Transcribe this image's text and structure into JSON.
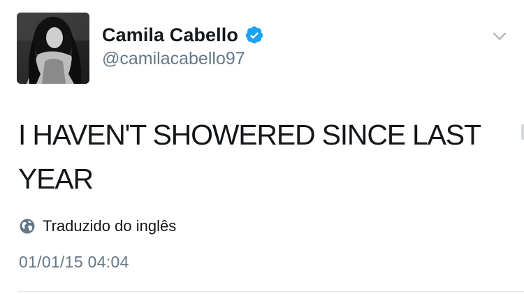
{
  "user": {
    "display_name": "Camila Cabello",
    "handle": "@camilacabello97",
    "verified": true,
    "avatar_icon": "profile-photo"
  },
  "tweet": {
    "text": "I HAVEN'T SHOWERED SINCE LAST YEAR",
    "translation_label": "Traduzido do inglês",
    "translation_icon": "globe-icon",
    "timestamp": "01/01/15 04:04"
  },
  "actions": {
    "menu_icon": "chevron-down-icon"
  },
  "colors": {
    "text_primary": "#14171a",
    "text_secondary": "#657786",
    "verified_blue": "#1da1f2",
    "divider": "#e1e8ed"
  }
}
